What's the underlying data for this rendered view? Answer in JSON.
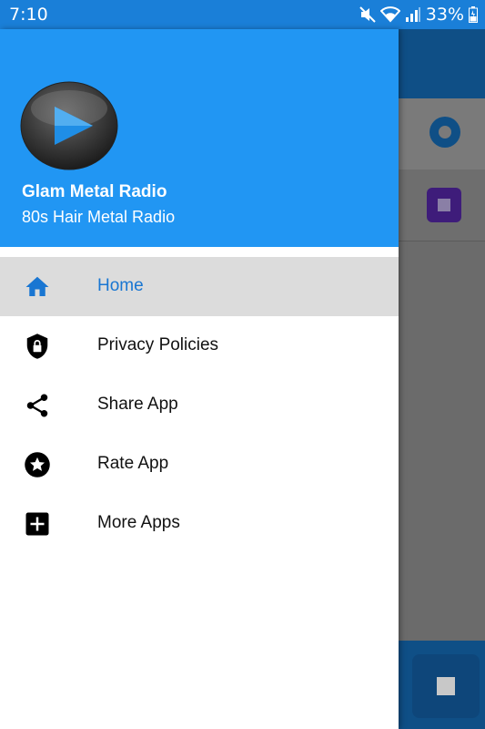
{
  "status_bar": {
    "time": "7:10",
    "battery": "33%",
    "icons": [
      "mute-icon",
      "wifi-icon",
      "signal-icon",
      "battery-icon"
    ]
  },
  "drawer": {
    "header": {
      "title": "Glam Metal Radio",
      "subtitle": "80s Hair Metal Radio",
      "color": "#2196f3"
    },
    "items": [
      {
        "label": "Home",
        "icon": "home-icon",
        "active": true
      },
      {
        "label": "Privacy Policies",
        "icon": "lock-shield-icon",
        "active": false
      },
      {
        "label": "Share App",
        "icon": "share-icon",
        "active": false
      },
      {
        "label": "Rate App",
        "icon": "star-icon",
        "active": false
      },
      {
        "label": "More Apps",
        "icon": "add-box-icon",
        "active": false
      }
    ]
  },
  "colors": {
    "accent": "#1976d2",
    "toolbar_dim": "#0f4f86",
    "scrim": "#6b6b6b"
  }
}
